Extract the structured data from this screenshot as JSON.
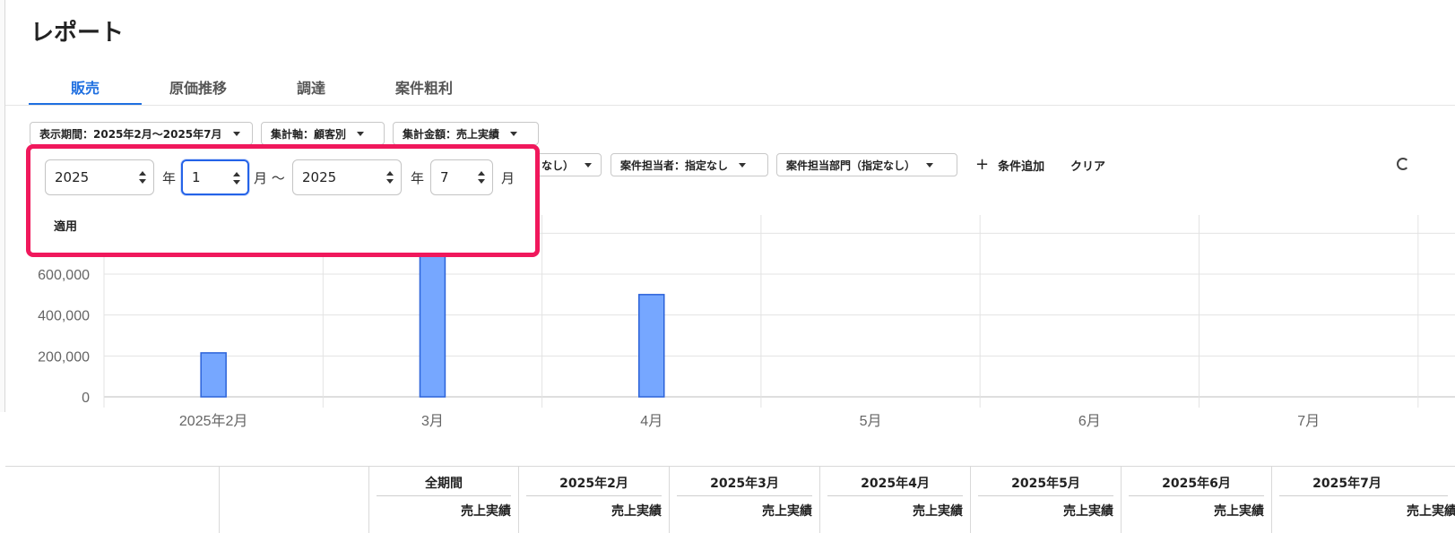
{
  "page": {
    "title": "レポート"
  },
  "tabs": [
    {
      "label": "販売",
      "active": true
    },
    {
      "label": "原価推移",
      "active": false
    },
    {
      "label": "調達",
      "active": false
    },
    {
      "label": "案件粗利",
      "active": false
    }
  ],
  "filters": {
    "period": "表示期間：2025年2月〜2025年7月",
    "axis": "集計軸：顧客別",
    "amount": "集計金額：売上実績",
    "hidden_partial": "なし）",
    "owner": "案件担当者：指定なし",
    "department": "案件担当部門（指定なし）",
    "add_condition": "条件追加",
    "clear": "クリア"
  },
  "popup": {
    "start_year": "2025",
    "start_month": "1",
    "end_year": "2025",
    "end_month": "7",
    "year_unit": "年",
    "month_unit": "月",
    "range_sep": "月 〜",
    "apply": "適用"
  },
  "chart_data": {
    "type": "bar",
    "categories": [
      "2025年2月",
      "3月",
      "4月",
      "5月",
      "6月",
      "7月"
    ],
    "series": [
      {
        "values": [
          215000,
          720000,
          500000,
          0,
          0,
          0
        ]
      }
    ],
    "y_ticks": [
      "0",
      "200,000",
      "400,000",
      "600,000"
    ],
    "ylim": [
      0,
      800000
    ],
    "bar_color": "#76a7ff",
    "bar_border": "#2b62d9",
    "grid": true
  },
  "table": {
    "headers": [
      {
        "top": "全期間",
        "sub": "売上実績"
      },
      {
        "top": "2025年2月",
        "sub": "売上実績"
      },
      {
        "top": "2025年3月",
        "sub": "売上実績"
      },
      {
        "top": "2025年4月",
        "sub": "売上実績"
      },
      {
        "top": "2025年5月",
        "sub": "売上実績"
      },
      {
        "top": "2025年6月",
        "sub": "売上実績"
      },
      {
        "top": "2025年7月",
        "sub": "売上実績"
      }
    ]
  },
  "colors": {
    "accent": "#1f6fe0",
    "popup_border": "#f0185c",
    "focus": "#2463e8"
  }
}
